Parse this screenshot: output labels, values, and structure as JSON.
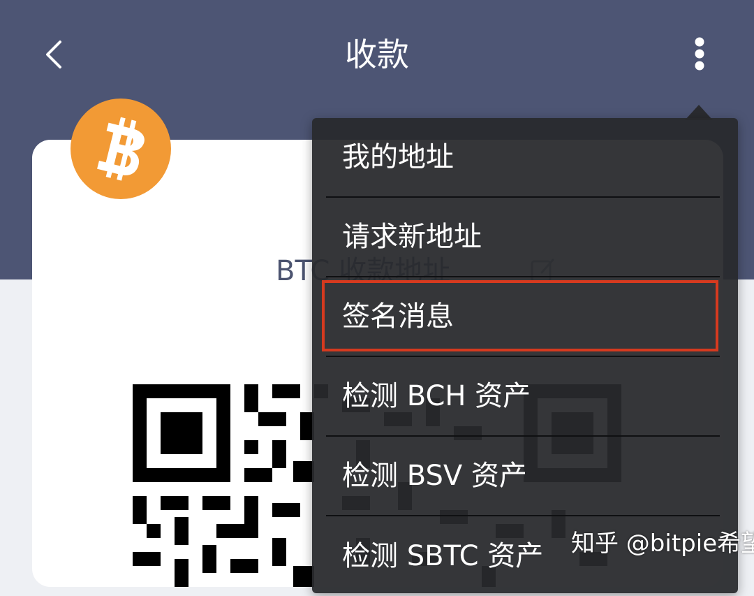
{
  "header": {
    "title": "收款",
    "back_icon": "chevron-left-icon",
    "more_icon": "more-vertical-icon",
    "background_color": "#4d5574"
  },
  "card": {
    "coin_icon": "bitcoin-icon",
    "coin_color": "#f29a35",
    "heading": "BTC 收款地址",
    "edit_icon": "edit-icon"
  },
  "menu": {
    "items": [
      {
        "label": "我的地址"
      },
      {
        "label": "请求新地址"
      },
      {
        "label": "签名消息",
        "highlighted": true
      },
      {
        "label": "检测 BCH 资产"
      },
      {
        "label": "检测 BSV 资产"
      },
      {
        "label": "检测 SBTC 资产"
      }
    ],
    "highlight_color": "#d63a1f"
  },
  "watermark": {
    "text": "知乎 @bitpie希望"
  }
}
